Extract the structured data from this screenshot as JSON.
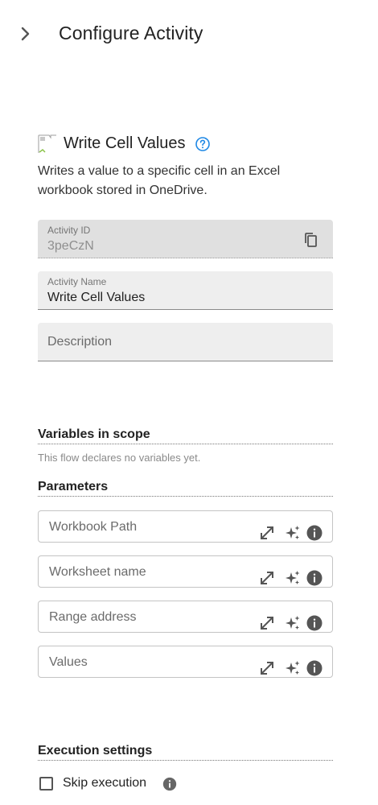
{
  "header": {
    "title": "Configure Activity",
    "collapse_icon": "chevron-right-icon"
  },
  "activity": {
    "icon": "broken-image-icon",
    "title": "Write Cell Values",
    "help_icon": "help-circle-icon",
    "description": "Writes a value to a specific cell in an Excel workbook stored in OneDrive."
  },
  "fields": {
    "activity_id": {
      "label": "Activity ID",
      "value": "3peCzN",
      "copy_icon": "copy-icon"
    },
    "activity_name": {
      "label": "Activity Name",
      "value": "Write Cell Values"
    },
    "description": {
      "placeholder": "Description"
    }
  },
  "variables": {
    "title": "Variables in scope",
    "note": "This flow declares no variables yet."
  },
  "parameters": {
    "title": "Parameters",
    "items": [
      {
        "placeholder": "Workbook Path"
      },
      {
        "placeholder": "Worksheet name"
      },
      {
        "placeholder": "Range address"
      },
      {
        "placeholder": "Values"
      }
    ],
    "tools": [
      "expand-icon",
      "ai-sparkle-icon",
      "info-icon"
    ]
  },
  "execution": {
    "title": "Execution settings",
    "skip_label": "Skip execution",
    "skip_checked": false
  },
  "colors": {
    "accent": "#1e88e5",
    "field_bg": "#eeeeee",
    "field_disabled_bg": "#e0e0e0",
    "icon": "#555555"
  }
}
